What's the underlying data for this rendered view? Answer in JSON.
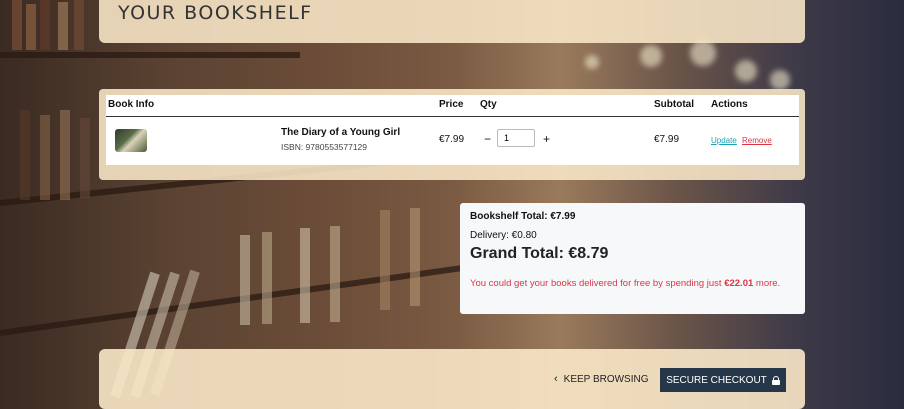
{
  "page": {
    "title": "YOUR BOOKSHELF"
  },
  "cart": {
    "headers": {
      "book_info": "Book Info",
      "price": "Price",
      "qty": "Qty",
      "subtotal": "Subtotal",
      "actions": "Actions"
    },
    "items": [
      {
        "title": "The Diary of a Young Girl",
        "isbn": "ISBN: 9780553577129",
        "price": "€7.99",
        "qty_minus": "−",
        "qty": "1",
        "qty_plus": "+",
        "subtotal": "€7.99",
        "update_label": "Update",
        "remove_label": "Remove"
      }
    ]
  },
  "summary": {
    "bookshelf_total": "Bookshelf Total: €7.99",
    "delivery": "Delivery: €0.80",
    "grand_total": "Grand Total: €8.79",
    "notice_prefix": "You could get your books delivered for free by spending just ",
    "notice_amount": "€22.01",
    "notice_suffix": " more."
  },
  "footer": {
    "keep_browsing_label": "KEEP BROWSING",
    "checkout_label": "SECURE CHECKOUT"
  },
  "colors": {
    "accent_dark": "#26374a",
    "link_update": "#17a2b8",
    "link_remove": "#dc3545",
    "card_beige": "#fae8c8"
  },
  "icons": {
    "keep_browsing": "chevron-left-icon",
    "checkout": "lock-icon",
    "thumbnail": "book-cover-image"
  }
}
